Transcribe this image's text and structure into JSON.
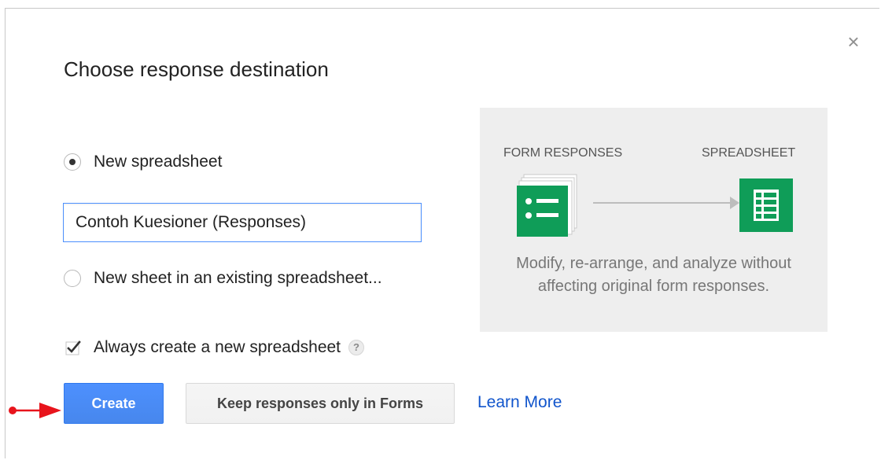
{
  "dialog": {
    "title": "Choose response destination",
    "close_label": "×"
  },
  "options": {
    "new_spreadsheet_label": "New spreadsheet",
    "new_spreadsheet_selected": true,
    "spreadsheet_name_value": "Contoh Kuesioner (Responses)",
    "existing_spreadsheet_label": "New sheet in an existing spreadsheet...",
    "always_create_label": "Always create a new spreadsheet",
    "always_create_checked": true,
    "help_label": "?"
  },
  "buttons": {
    "create_label": "Create",
    "keep_label": "Keep responses only in Forms",
    "learn_more_label": "Learn More"
  },
  "info_panel": {
    "source_heading": "FORM RESPONSES",
    "target_heading": "SPREADSHEET",
    "description_line1": "Modify, re-arrange, and analyze without",
    "description_line2": "affecting original form responses."
  },
  "colors": {
    "primary_button": "#4d90fe",
    "link": "#1155cc",
    "icon_green": "#0f9d58",
    "annotation_arrow": "#e8141c",
    "panel_bg": "#eeeeee"
  },
  "icons": [
    "close-icon",
    "radio-icon",
    "checkbox-check-icon",
    "help-icon",
    "form-icon",
    "spreadsheet-icon",
    "arrow-icon",
    "annotation-arrow-icon"
  ]
}
